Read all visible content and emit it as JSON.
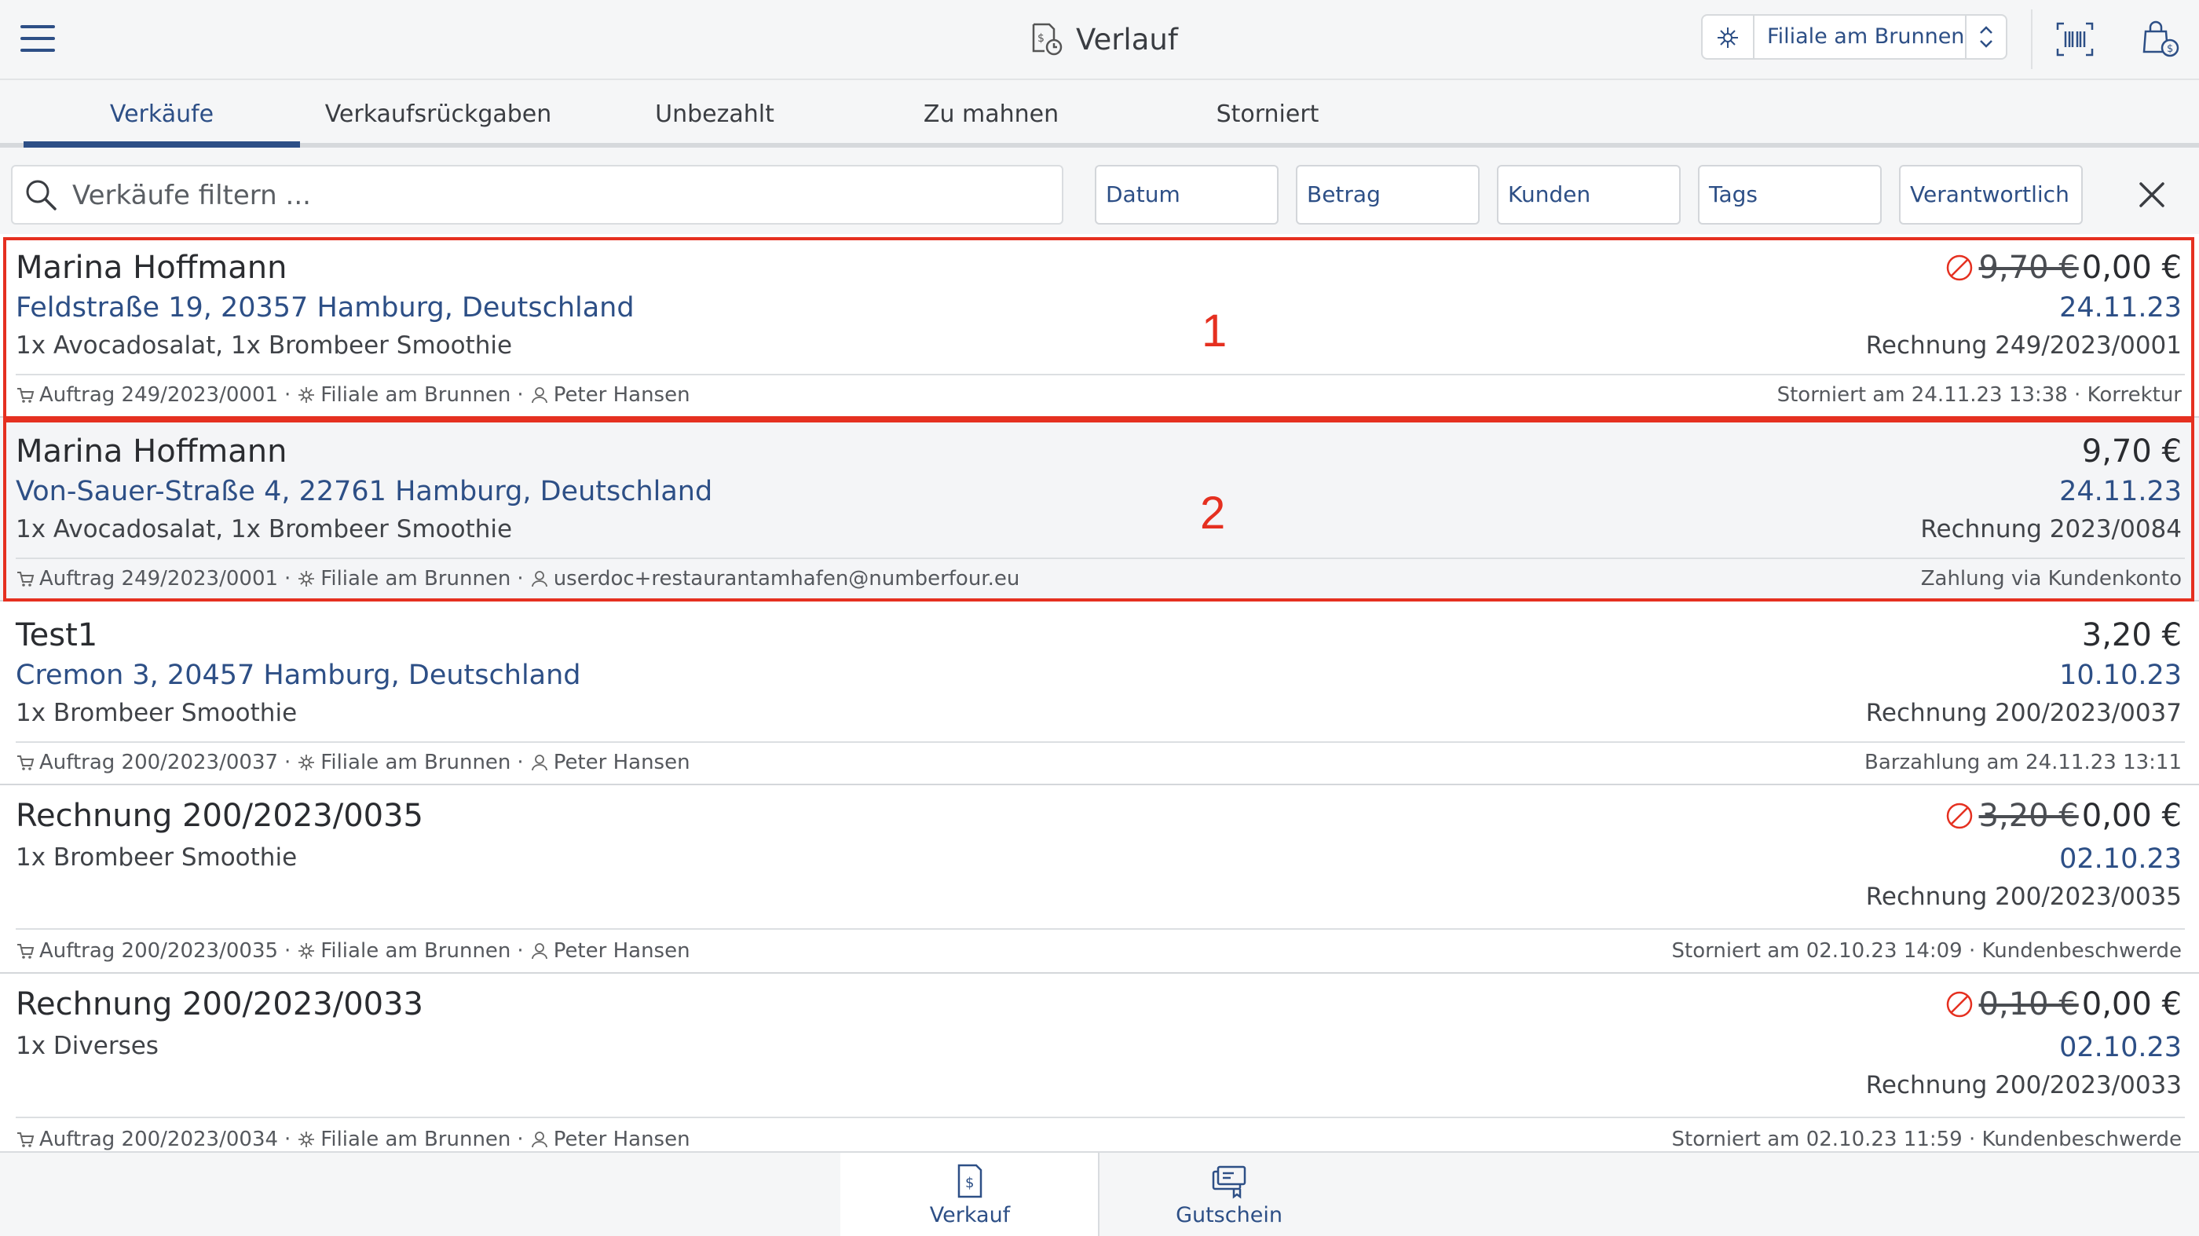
{
  "header": {
    "title": "Verlauf",
    "branch": "Filiale am Brunnen"
  },
  "tabs": [
    {
      "label": "Verkäufe",
      "active": true
    },
    {
      "label": "Verkaufsrückgaben",
      "active": false
    },
    {
      "label": "Unbezahlt",
      "active": false
    },
    {
      "label": "Zu mahnen",
      "active": false
    },
    {
      "label": "Storniert",
      "active": false
    }
  ],
  "filter": {
    "placeholder": "Verkäufe filtern ...",
    "chips": [
      "Datum",
      "Betrag",
      "Kunden",
      "Tags",
      "Verantwortlich"
    ]
  },
  "sales": [
    {
      "name": "Marina Hoffmann",
      "address": "Feldstraße 19, 20357 Hamburg, Deutschland",
      "items": "1x Avocadosalat, 1x Brombeer Smoothie",
      "old_price": "9,70 €",
      "price": "0,00 €",
      "date": "24.11.23",
      "invoice": "Rechnung 249/2023/0001",
      "order": "Auftrag 249/2023/0001",
      "branch": "Filiale am Brunnen",
      "user": "Peter Hansen",
      "status": "Storniert am 24.11.23 13:38 · Korrektur"
    },
    {
      "name": "Marina Hoffmann",
      "address": "Von-Sauer-Straße 4, 22761 Hamburg, Deutschland",
      "items": "1x Avocadosalat, 1x Brombeer Smoothie",
      "price": "9,70 €",
      "date": "24.11.23",
      "invoice": "Rechnung 2023/0084",
      "order": "Auftrag 249/2023/0001",
      "branch": "Filiale am Brunnen",
      "user": "userdoc+restaurantamhafen@numberfour.eu",
      "status": "Zahlung via Kundenkonto"
    },
    {
      "name": "Test1",
      "address": "Cremon 3, 20457 Hamburg, Deutschland",
      "items": "1x Brombeer Smoothie",
      "price": "3,20 €",
      "date": "10.10.23",
      "invoice": "Rechnung 200/2023/0037",
      "order": "Auftrag 200/2023/0037",
      "branch": "Filiale am Brunnen",
      "user": "Peter Hansen",
      "status": "Barzahlung am 24.11.23 13:11"
    },
    {
      "name": "Rechnung 200/2023/0035",
      "items": "1x Brombeer Smoothie",
      "old_price": "3,20 €",
      "price": "0,00 €",
      "date": "02.10.23",
      "invoice": "Rechnung 200/2023/0035",
      "order": "Auftrag 200/2023/0035",
      "branch": "Filiale am Brunnen",
      "user": "Peter Hansen",
      "status": "Storniert am 02.10.23 14:09 · Kundenbeschwerde"
    },
    {
      "name": "Rechnung 200/2023/0033",
      "items": "1x Diverses",
      "old_price": "0,10 €",
      "price": "0,00 €",
      "date": "02.10.23",
      "invoice": "Rechnung 200/2023/0033",
      "order": "Auftrag 200/2023/0034",
      "branch": "Filiale am Brunnen",
      "user": "Peter Hansen",
      "status": "Storniert am 02.10.23 11:59 · Kundenbeschwerde"
    }
  ],
  "annotations": [
    "1",
    "2"
  ],
  "bottom_nav": [
    {
      "label": "Verkauf",
      "icon": "receipt-icon",
      "active": true
    },
    {
      "label": "Gutschein",
      "icon": "voucher-icon",
      "active": false
    }
  ],
  "colors": {
    "accent": "#2d4f86",
    "highlight": "#e53020",
    "cancel": "#e53020"
  }
}
